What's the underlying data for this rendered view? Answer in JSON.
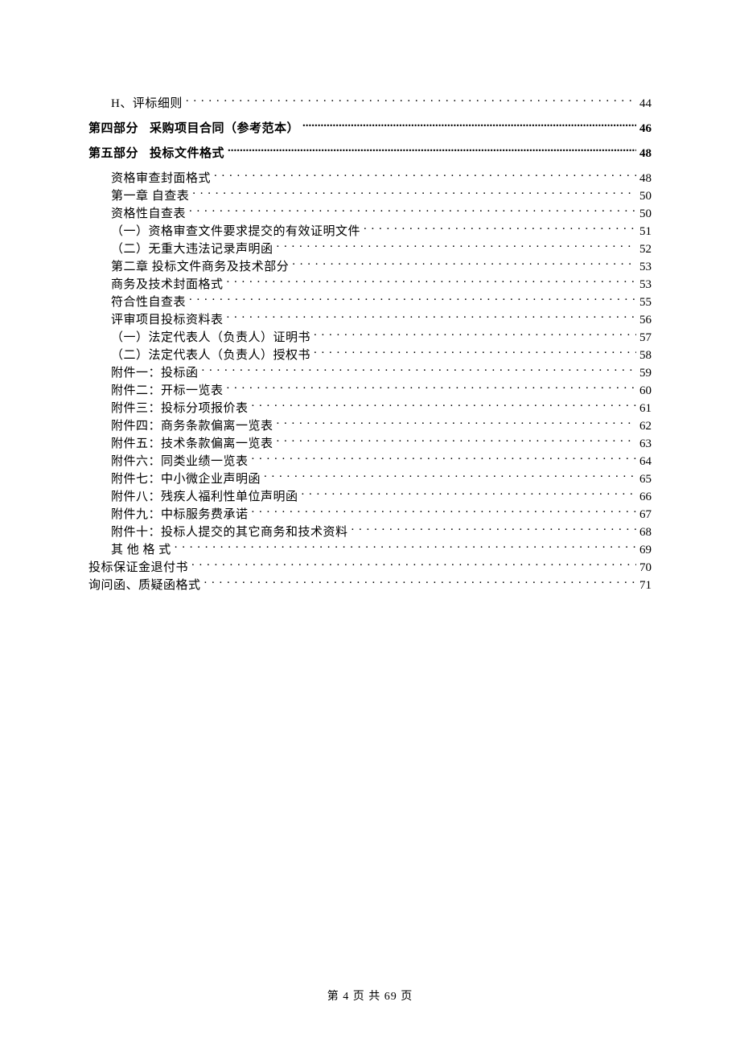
{
  "toc": [
    {
      "label": "H、评标细则",
      "page": "44",
      "level": "l1"
    },
    {
      "gap": true
    },
    {
      "part_prefix": "第四部分",
      "label": "采购项目合同（参考范本）",
      "page": "46",
      "level": "l0"
    },
    {
      "gap": true
    },
    {
      "part_prefix": "第五部分",
      "label": "投标文件格式",
      "page": "48",
      "level": "l0"
    },
    {
      "gap": true
    },
    {
      "label": "资格审查封面格式",
      "page": "48",
      "level": "l1"
    },
    {
      "label": "第一章 自查表",
      "page": "50",
      "level": "l1"
    },
    {
      "label": "资格性自查表",
      "page": "50",
      "level": "l1"
    },
    {
      "label": "（一）资格审查文件要求提交的有效证明文件",
      "page": "51",
      "level": "l2"
    },
    {
      "label": "（二）无重大违法记录声明函",
      "page": "52",
      "level": "l2"
    },
    {
      "label": "第二章 投标文件商务及技术部分",
      "page": "53",
      "level": "l1"
    },
    {
      "label": "商务及技术封面格式",
      "page": "53",
      "level": "l1"
    },
    {
      "label": "符合性自查表",
      "page": "55",
      "level": "l1"
    },
    {
      "label": "评审项目投标资料表",
      "page": "56",
      "level": "l1"
    },
    {
      "label": "（一）法定代表人（负责人）证明书",
      "page": "57",
      "level": "l2"
    },
    {
      "label": "（二）法定代表人（负责人）授权书",
      "page": "58",
      "level": "l2"
    },
    {
      "label": "附件一：投标函",
      "page": "59",
      "level": "l1"
    },
    {
      "label": "附件二：开标一览表",
      "page": "60",
      "level": "l1"
    },
    {
      "label": "附件三：投标分项报价表",
      "page": "61",
      "level": "l1"
    },
    {
      "label": "附件四：商务条款偏离一览表",
      "page": "62",
      "level": "l1"
    },
    {
      "label": "附件五：技术条款偏离一览表",
      "page": "63",
      "level": "l1"
    },
    {
      "label": "附件六：同类业绩一览表",
      "page": "64",
      "level": "l1"
    },
    {
      "label": "附件七：中小微企业声明函",
      "page": "65",
      "level": "l1"
    },
    {
      "label": "附件八：残疾人福利性单位声明函",
      "page": "66",
      "level": "l1"
    },
    {
      "label": "附件九：中标服务费承诺",
      "page": "67",
      "level": "l1"
    },
    {
      "label": "附件十：投标人提交的其它商务和技术资料",
      "page": "68",
      "level": "l1"
    },
    {
      "label": "其 他 格 式",
      "page": "69",
      "level": "l1"
    },
    {
      "label": "投标保证金退付书",
      "page": "70",
      "level": "lroot"
    },
    {
      "label": "询问函、质疑函格式",
      "page": "71",
      "level": "lroot"
    }
  ],
  "footer": "第 4 页 共 69 页"
}
